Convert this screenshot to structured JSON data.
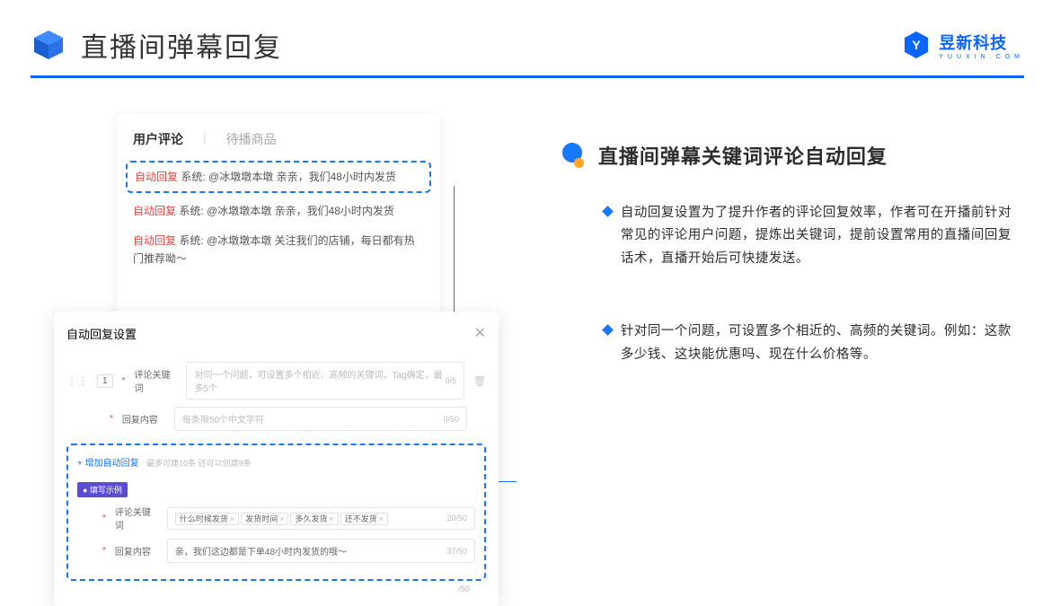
{
  "header": {
    "title": "直播间弹幕回复",
    "logo_text": "昱新科技",
    "logo_sub": "YUUXIN.COM"
  },
  "comments": {
    "tab1": "用户评论",
    "tab2": "待播商品",
    "tag": "自动回复",
    "sys_prefix": "系统:",
    "row1": "@冰墩墩本墩 亲亲，我们48小时内发货",
    "row2": "@冰墩墩本墩 亲亲，我们48小时内发货",
    "row3": "@冰墩墩本墩 关注我们的店铺，每日都有热门推荐呦～"
  },
  "modal": {
    "title": "自动回复设置",
    "num": "1",
    "kw_label": "评论关键词",
    "kw_placeholder": "对同一个问题，可设置多个相近、高频的关键词，Tag确定，最多5个",
    "kw_counter": "0/5",
    "content_label": "回复内容",
    "content_placeholder": "每条限50个中文字符",
    "content_counter": "0/50",
    "add_link": "+ 增加自动回复",
    "add_hint": "最多可建10条 还可以创建9条",
    "example_chip": "● 填写示例",
    "ex_kw_label": "评论关键词",
    "ex_tags": [
      "什么时候发货",
      "发货时间",
      "多久发货",
      "还不发货"
    ],
    "ex_kw_counter": "20/50",
    "ex_content_label": "回复内容",
    "ex_content_value": "亲，我们这边都是下单48小时内发货的哦～",
    "ex_content_counter": "37/50",
    "trailing_counter": "/50"
  },
  "right": {
    "heading": "直播间弹幕关键词评论自动回复",
    "bullet1": "自动回复设置为了提升作者的评论回复效率，作者可在开播前针对常见的评论用户问题，提炼出关键词，提前设置常用的直播间回复话术，直播开始后可快捷发送。",
    "bullet2": "针对同一个问题，可设置多个相近的、高频的关键词。例如：这款多少钱、这块能优惠吗、现在什么价格等。"
  }
}
